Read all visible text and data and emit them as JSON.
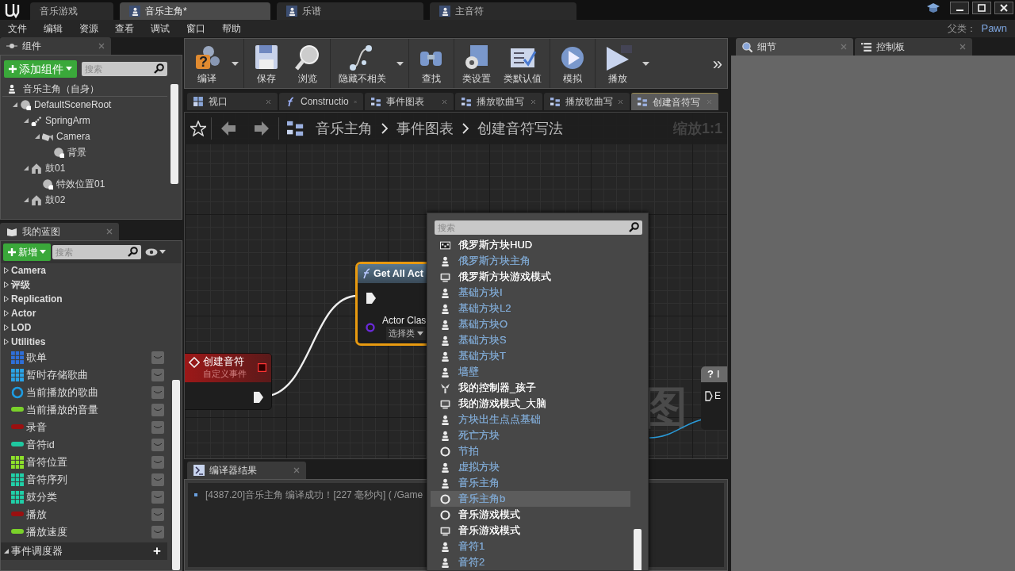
{
  "title_tabs": [
    {
      "label": "音乐游戏",
      "kind": "project",
      "selected": false
    },
    {
      "label": "音乐主角*",
      "kind": "pawn",
      "selected": true
    },
    {
      "label": "乐谱",
      "kind": "pawn",
      "selected": false
    },
    {
      "label": "主音符",
      "kind": "pawn",
      "selected": false
    }
  ],
  "menu": [
    "文件",
    "编辑",
    "资源",
    "查看",
    "调试",
    "窗口",
    "帮助"
  ],
  "parent_class": {
    "label": "父类：",
    "value": "Pawn"
  },
  "components": {
    "tab": "组件",
    "add_button": "添加组件",
    "search": {
      "placeholder": "搜索"
    },
    "root": "音乐主角（自身）",
    "tree": [
      {
        "label": "DefaultSceneRoot",
        "kind": "sphere",
        "expanded": true,
        "children": [
          {
            "label": "SpringArm",
            "kind": "spring",
            "expanded": true,
            "children": [
              {
                "label": "Camera",
                "kind": "camera",
                "expanded": true,
                "children": [
                  {
                    "label": "背景",
                    "kind": "sphere"
                  }
                ]
              }
            ]
          },
          {
            "label": "鼓01",
            "kind": "house",
            "expanded": true,
            "children": [
              {
                "label": "特效位置01",
                "kind": "sphere"
              }
            ]
          },
          {
            "label": "鼓02",
            "kind": "house",
            "expanded": true
          }
        ]
      }
    ]
  },
  "my_blueprint": {
    "tab": "我的蓝图",
    "add_button": "新增",
    "search": {
      "placeholder": "搜索"
    },
    "categories": [
      "Camera",
      "评级",
      "Replication",
      "Actor",
      "LOD",
      "Utilities"
    ],
    "variables": [
      {
        "label": "歌单",
        "kind": "grid",
        "color": "#2f6fd8"
      },
      {
        "label": "暂时存储歌曲",
        "kind": "grid",
        "color": "#2aa4e8"
      },
      {
        "label": "当前播放的歌曲",
        "kind": "ring",
        "color": "#1e9be0"
      },
      {
        "label": "当前播放的音量",
        "kind": "pill",
        "color": "#7ad12a"
      },
      {
        "label": "录音",
        "kind": "pill",
        "color": "#9a1010"
      },
      {
        "label": "音符id",
        "kind": "pill",
        "color": "#1fc8a0"
      },
      {
        "label": "音符位置",
        "kind": "grid",
        "color": "#8ee02a"
      },
      {
        "label": "音符序列",
        "kind": "grid",
        "color": "#20d0a8"
      },
      {
        "label": "鼓分类",
        "kind": "grid",
        "color": "#20d0a8"
      },
      {
        "label": "播放",
        "kind": "pill",
        "color": "#9a1010"
      },
      {
        "label": "播放速度",
        "kind": "pill",
        "color": "#7ad12a"
      }
    ],
    "section": {
      "label": "事件调度器",
      "expanded": true,
      "add": "+"
    }
  },
  "toolbar": [
    [
      {
        "label": "编译",
        "kind": "compile",
        "menu": true,
        "badge": "?"
      }
    ],
    [
      {
        "label": "保存",
        "kind": "save",
        "menu": false
      },
      {
        "label": "浏览",
        "kind": "browse",
        "menu": false
      }
    ],
    [
      {
        "label": "隐藏不相关",
        "kind": "hide",
        "menu": true
      }
    ],
    [
      {
        "label": "查找",
        "kind": "find",
        "menu": false
      }
    ],
    [
      {
        "label": "类设置",
        "kind": "settings",
        "menu": false
      },
      {
        "label": "类默认值",
        "kind": "defaults",
        "menu": false
      }
    ],
    [
      {
        "label": "模拟",
        "kind": "simulate",
        "menu": false
      }
    ],
    [
      {
        "label": "播放",
        "kind": "play",
        "menu": true
      }
    ]
  ],
  "overflow": "»",
  "doc_tabs": [
    {
      "label": "视口",
      "kind": "viewport",
      "selected": false
    },
    {
      "label": "Constructio",
      "kind": "function",
      "selected": false
    },
    {
      "label": "事件图表",
      "kind": "graph",
      "selected": false
    },
    {
      "label": "播放歌曲写",
      "kind": "graph",
      "selected": false
    },
    {
      "label": "播放歌曲写",
      "kind": "graph",
      "selected": false
    },
    {
      "label": "创建音符写",
      "kind": "graph",
      "selected": true
    }
  ],
  "breadcrumb": [
    "音乐主角",
    "事件图表",
    "创建音符写法"
  ],
  "zoom_label": "缩放1:1",
  "graph": {
    "watermark": "图",
    "event_node": {
      "title": "创建音符",
      "subtitle": "自定义事件"
    },
    "function_node": {
      "title": "Get All Act",
      "pin": "Actor Clas",
      "picker": "选择类"
    },
    "partial_node": {
      "badge": "?",
      "title": "I",
      "pin": "E"
    }
  },
  "compiler": {
    "tab": "编译器结果",
    "messages": [
      "[4387.20]音乐主角 编译成功！[227 毫秒内] ( /Game"
    ]
  },
  "class_picker": {
    "search": {
      "placeholder": "搜索"
    },
    "items": [
      {
        "label": "俄罗斯方块HUD",
        "kind": "hud",
        "color": "#ffffff",
        "selected": false
      },
      {
        "label": "俄罗斯方块主角",
        "kind": "pawn",
        "color": "#7ea6cf",
        "selected": false
      },
      {
        "label": "俄罗斯方块游戏模式",
        "kind": "gamemode",
        "color": "#ffffff",
        "selected": false
      },
      {
        "label": "基础方块I",
        "kind": "pawn",
        "color": "#7ea6cf",
        "selected": false
      },
      {
        "label": "基础方块L2",
        "kind": "pawn",
        "color": "#7ea6cf",
        "selected": false
      },
      {
        "label": "基础方块O",
        "kind": "pawn",
        "color": "#7ea6cf",
        "selected": false
      },
      {
        "label": "基础方块S",
        "kind": "pawn",
        "color": "#7ea6cf",
        "selected": false
      },
      {
        "label": "基础方块T",
        "kind": "pawn",
        "color": "#7ea6cf",
        "selected": false
      },
      {
        "label": "墙壁",
        "kind": "pawn",
        "color": "#7ea6cf",
        "selected": false
      },
      {
        "label": "我的控制器_孩子",
        "kind": "controller",
        "color": "#ffffff",
        "selected": false
      },
      {
        "label": "我的游戏模式_大脑",
        "kind": "gamemode",
        "color": "#ffffff",
        "selected": false
      },
      {
        "label": "方块出生点点基础",
        "kind": "pawn",
        "color": "#7ea6cf",
        "selected": false
      },
      {
        "label": "死亡方块",
        "kind": "pawn",
        "color": "#7ea6cf",
        "selected": false
      },
      {
        "label": "节拍",
        "kind": "ring",
        "color": "#7ea6cf",
        "selected": false
      },
      {
        "label": "虚拟方块",
        "kind": "pawn",
        "color": "#7ea6cf",
        "selected": false
      },
      {
        "label": "音乐主角",
        "kind": "pawn",
        "color": "#7ea6cf",
        "selected": false
      },
      {
        "label": "音乐主角b",
        "kind": "ring",
        "color": "#7ea6cf",
        "selected": true
      },
      {
        "label": "音乐游戏模式",
        "kind": "ring",
        "color": "#ffffff",
        "selected": false
      },
      {
        "label": "音乐游戏模式",
        "kind": "gamemode",
        "color": "#ffffff",
        "selected": false
      },
      {
        "label": "音符1",
        "kind": "pawn",
        "color": "#7ea6cf",
        "selected": false
      },
      {
        "label": "音符2",
        "kind": "pawn",
        "color": "#7ea6cf",
        "selected": false
      }
    ]
  },
  "right_tabs": [
    {
      "label": "细节",
      "kind": "details",
      "selected": true
    },
    {
      "label": "控制板",
      "kind": "palette",
      "selected": false
    }
  ]
}
